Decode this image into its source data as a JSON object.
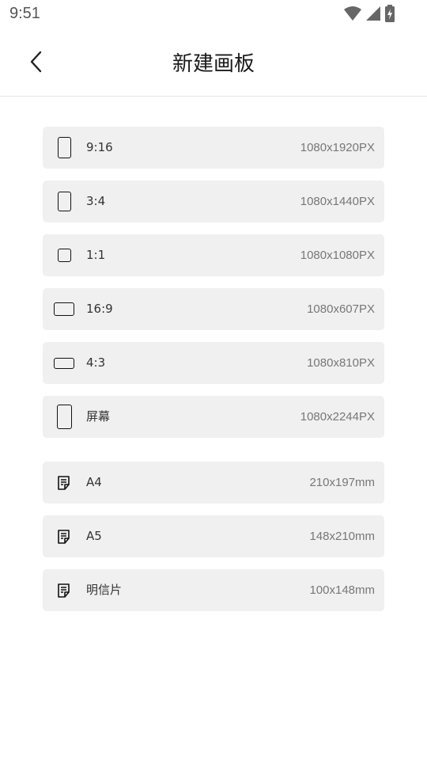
{
  "status_bar": {
    "time": "9:51",
    "icons": [
      "wifi-icon",
      "cellular-signal-icon",
      "battery-charging-icon"
    ]
  },
  "header": {
    "back_icon": "chevron-left-icon",
    "title": "新建画板"
  },
  "screen_sizes": [
    {
      "label": "9:16",
      "size": "1080x1920PX",
      "icon": "portrait-9-16-icon"
    },
    {
      "label": "3:4",
      "size": "1080x1440PX",
      "icon": "portrait-3-4-icon"
    },
    {
      "label": "1:1",
      "size": "1080x1080PX",
      "icon": "square-1-1-icon"
    },
    {
      "label": "16:9",
      "size": "1080x607PX",
      "icon": "landscape-16-9-icon"
    },
    {
      "label": "4:3",
      "size": "1080x810PX",
      "icon": "landscape-4-3-icon"
    },
    {
      "label": "屏幕",
      "size": "1080x2244PX",
      "icon": "screen-icon"
    }
  ],
  "paper_sizes": [
    {
      "label": "A4",
      "size": "210x197mm",
      "icon": "document-icon"
    },
    {
      "label": "A5",
      "size": "148x210mm",
      "icon": "document-icon"
    },
    {
      "label": "明信片",
      "size": "100x148mm",
      "icon": "document-icon"
    }
  ]
}
